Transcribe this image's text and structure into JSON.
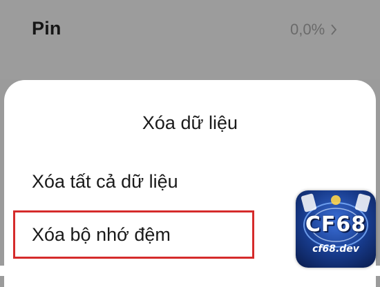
{
  "background_screen": {
    "row_title": "Pin",
    "row_value": "0,0%",
    "chevron_icon": "chevron-right-icon"
  },
  "dialog": {
    "title": "Xóa dữ liệu",
    "options": [
      {
        "label": "Xóa tất cả dữ liệu",
        "highlighted": false
      },
      {
        "label": "Xóa bộ nhớ đệm",
        "highlighted": true
      }
    ],
    "highlight_color": "#d52b2b"
  },
  "watermark": {
    "brand": "CF68",
    "site": "cf68.dev"
  }
}
